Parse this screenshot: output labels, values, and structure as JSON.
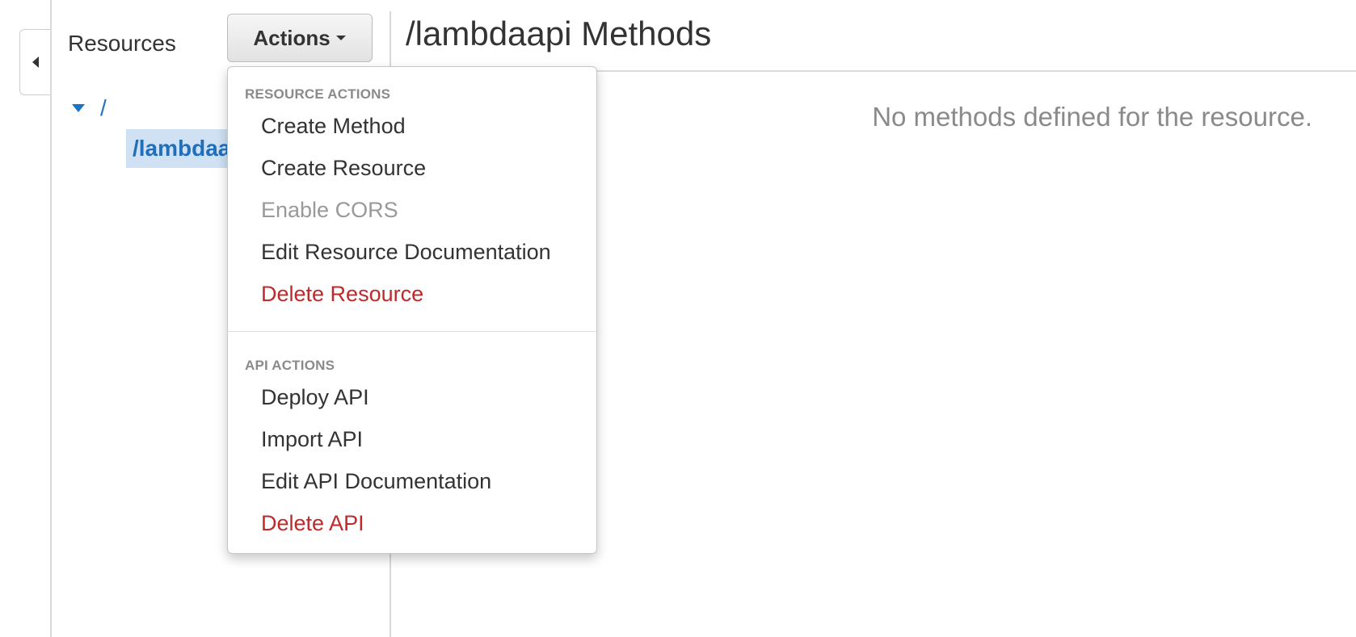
{
  "sidebar": {
    "title": "Resources",
    "tree": {
      "root_label": "/",
      "child_label": "/lambdaapi"
    }
  },
  "actions_button": {
    "label": "Actions"
  },
  "actions_menu": {
    "resource_header": "RESOURCE ACTIONS",
    "resource_items": [
      {
        "label": "Create Method",
        "state": "enabled"
      },
      {
        "label": "Create Resource",
        "state": "enabled"
      },
      {
        "label": "Enable CORS",
        "state": "disabled"
      },
      {
        "label": "Edit Resource Documentation",
        "state": "enabled"
      },
      {
        "label": "Delete Resource",
        "state": "danger"
      }
    ],
    "api_header": "API ACTIONS",
    "api_items": [
      {
        "label": "Deploy API",
        "state": "enabled"
      },
      {
        "label": "Import API",
        "state": "enabled"
      },
      {
        "label": "Edit API Documentation",
        "state": "enabled"
      },
      {
        "label": "Delete API",
        "state": "danger"
      }
    ]
  },
  "main": {
    "title": "/lambdaapi Methods",
    "empty_message": "No methods defined for the resource."
  },
  "colors": {
    "link_blue": "#1a73c7",
    "selected_bg": "#cfe1f3",
    "danger_red": "#c0282a",
    "disabled_gray": "#999999"
  }
}
